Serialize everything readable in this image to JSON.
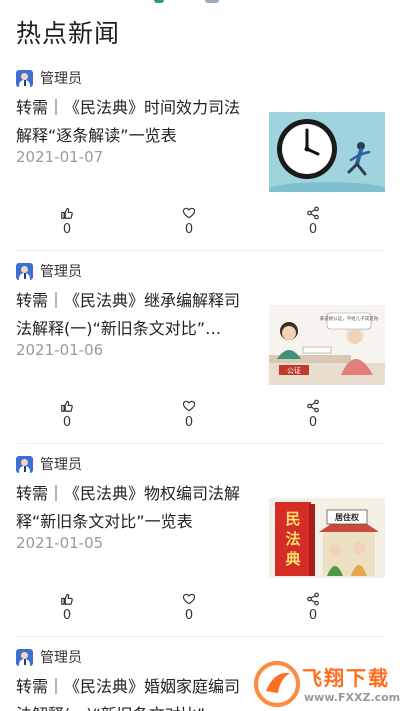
{
  "page": {
    "title": "热点新闻"
  },
  "articles": [
    {
      "author": "管理员",
      "title": "转需｜《民法典》时间效力司法解释“逐条解读”一览表",
      "date": "2021-01-07",
      "likes": "0",
      "favorites": "0",
      "shares": "0",
      "thumbnail": "clock-running-person"
    },
    {
      "author": "管理员",
      "title": "转需｜《民法典》继承编解释司法解释(一)“新旧条文对比”…",
      "date": "2021-01-06",
      "likes": "0",
      "favorites": "0",
      "shares": "0",
      "thumbnail": "notary-office",
      "thumb_sign": "公证",
      "thumb_bubble": "来说继公证，平给儿子或是你"
    },
    {
      "author": "管理员",
      "title": "转需｜《民法典》物权编司法解释“新旧条文对比”一览表",
      "date": "2021-01-05",
      "likes": "0",
      "favorites": "0",
      "shares": "0",
      "thumbnail": "civil-code-book",
      "thumb_book": "民法典",
      "thumb_sign": "居住权"
    },
    {
      "author": "管理员",
      "title": "转需｜《民法典》婚姻家庭编司法解释(一)“新旧条文对比”"
    }
  ],
  "watermark": {
    "title": "飞翔下载",
    "url": "www.FXXZ.com"
  },
  "colors": {
    "avatar": "#3c6fd1",
    "date": "#9a9a9a",
    "watermark": "#ff6d1f"
  }
}
